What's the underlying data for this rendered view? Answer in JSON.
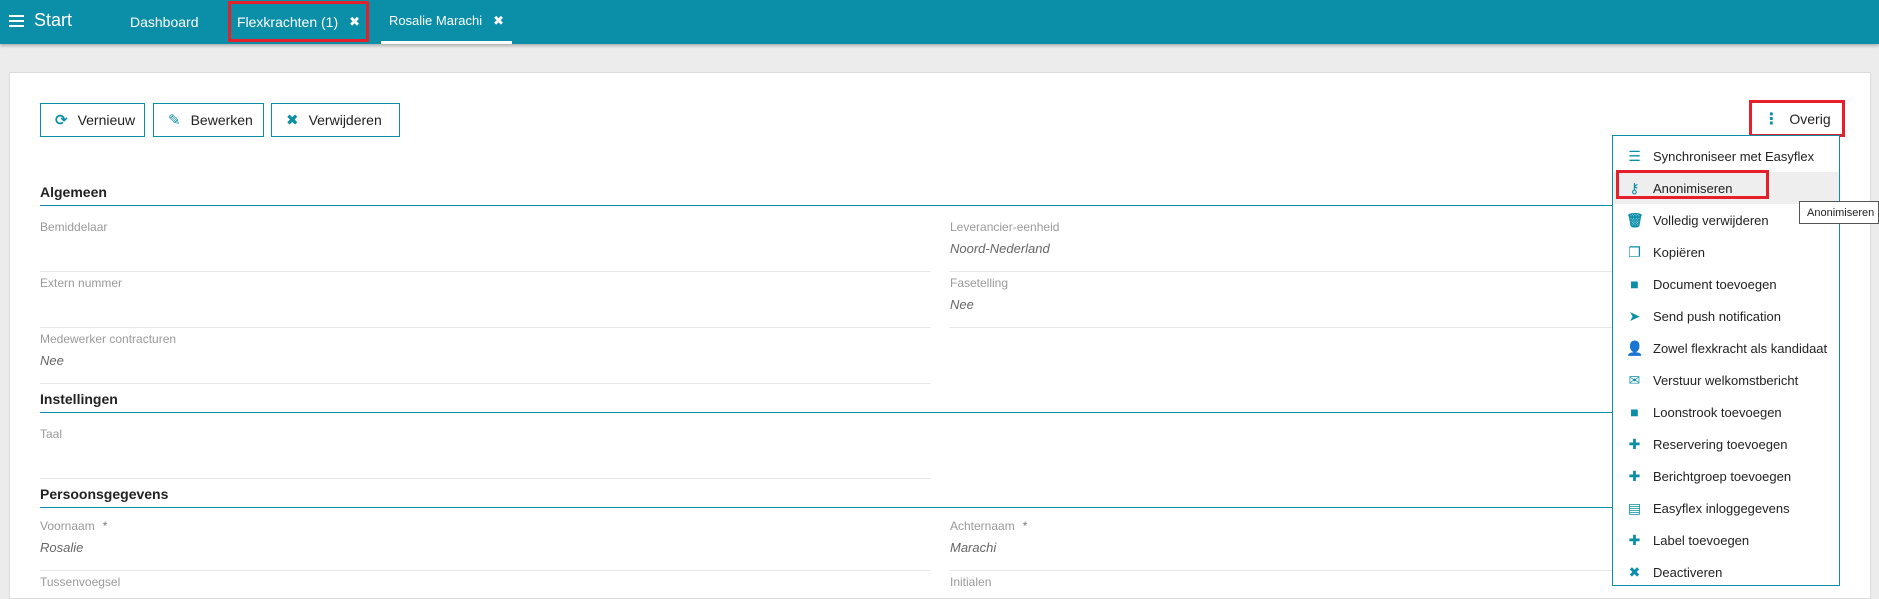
{
  "topbar": {
    "start_label": "Start",
    "tabs": [
      {
        "label": "Dashboard"
      },
      {
        "label": "Flexkrachten (1)",
        "close": "✖"
      },
      {
        "label": "Rosalie Marachi",
        "close": "✖"
      }
    ]
  },
  "toolbar": {
    "vernieuw_label": "Vernieuw",
    "bewerken_label": "Bewerken",
    "verwijderen_label": "Verwijderen",
    "overig_label": "Overig"
  },
  "sections": {
    "algemeen": "Algemeen",
    "instellingen": "Instellingen",
    "persoonsgegevens": "Persoonsgegevens"
  },
  "fields": {
    "bemiddelaar": {
      "label": "Bemiddelaar",
      "value": ""
    },
    "leverancier": {
      "label": "Leverancier-eenheid",
      "value": "Noord-Nederland"
    },
    "extern": {
      "label": "Extern nummer",
      "value": ""
    },
    "fasetelling": {
      "label": "Fasetelling",
      "value": "Nee"
    },
    "medewerker": {
      "label": "Medewerker contracturen",
      "value": "Nee"
    },
    "taal": {
      "label": "Taal",
      "value": ""
    },
    "voornaam": {
      "label": "Voornaam",
      "required": "*",
      "value": "Rosalie"
    },
    "achternaam": {
      "label": "Achternaam",
      "required": "*",
      "value": "Marachi"
    },
    "tussenvoegsel": {
      "label": "Tussenvoegsel",
      "value": ""
    },
    "initialen": {
      "label": "Initialen",
      "value": ""
    }
  },
  "menu": {
    "items": [
      {
        "label": "Synchroniseer met Easyflex",
        "icon": "list-icon"
      },
      {
        "label": "Anonimiseren",
        "icon": "key-icon"
      },
      {
        "label": "Volledig verwijderen",
        "icon": "trash-icon"
      },
      {
        "label": "Kopiëren",
        "icon": "copy-icon"
      },
      {
        "label": "Document toevoegen",
        "icon": "folder-icon"
      },
      {
        "label": "Send push notification",
        "icon": "paper-plane-icon"
      },
      {
        "label": "Zowel flexkracht als kandidaat",
        "icon": "user-plus-icon"
      },
      {
        "label": "Verstuur welkomstbericht",
        "icon": "envelope-icon"
      },
      {
        "label": "Loonstrook toevoegen",
        "icon": "folder-icon"
      },
      {
        "label": "Reservering toevoegen",
        "icon": "plus-icon"
      },
      {
        "label": "Berichtgroep toevoegen",
        "icon": "plus-icon"
      },
      {
        "label": "Easyflex inloggegevens",
        "icon": "id-card-icon"
      },
      {
        "label": "Label toevoegen",
        "icon": "plus-icon"
      },
      {
        "label": "Deactiveren",
        "icon": "times-icon"
      }
    ]
  },
  "tooltip": "Anonimiseren",
  "colors": {
    "primary": "#0b8ea8",
    "highlight": "#e5202b"
  }
}
